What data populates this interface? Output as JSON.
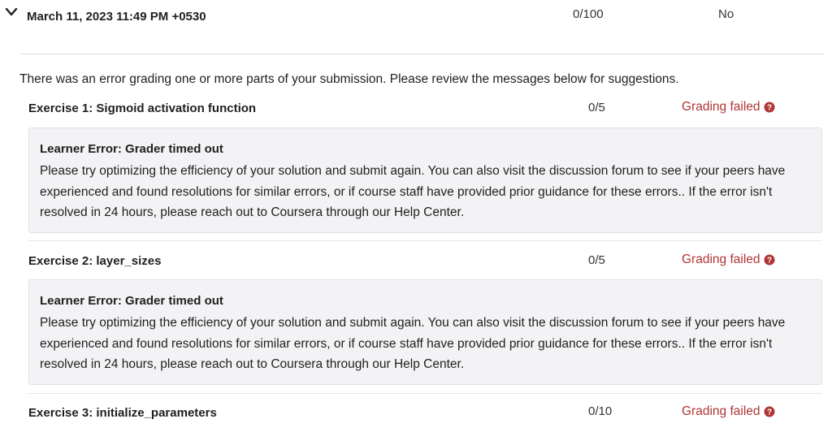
{
  "submission": {
    "date": "March 11, 2023 11:49 PM +0530",
    "score": "0/100",
    "passed": "No"
  },
  "error_message": "There was an error grading one or more parts of your submission. Please review the messages below for suggestions.",
  "exercises": [
    {
      "title": "Exercise 1: Sigmoid activation function",
      "score": "0/5",
      "status": "Grading failed",
      "error": {
        "title": "Learner Error: Grader timed out",
        "body": "Please try optimizing the efficiency of your solution and submit again. You can also visit the discussion forum to see if your peers have experienced and found resolutions for similar errors, or if course staff have provided prior guidance for these errors.. If the error isn't resolved in 24 hours, please reach out to Coursera through our Help Center."
      }
    },
    {
      "title": "Exercise 2: layer_sizes",
      "score": "0/5",
      "status": "Grading failed",
      "error": {
        "title": "Learner Error: Grader timed out",
        "body": "Please try optimizing the efficiency of your solution and submit again. You can also visit the discussion forum to see if your peers have experienced and found resolutions for similar errors, or if course staff have provided prior guidance for these errors.. If the error isn't resolved in 24 hours, please reach out to Coursera through our Help Center."
      }
    },
    {
      "title": "Exercise 3: initialize_parameters",
      "score": "0/10",
      "status": "Grading failed"
    }
  ],
  "icons": {
    "expand": "chevron-down-icon",
    "help": "question-circle-icon"
  },
  "colors": {
    "status_failed": "#b03636",
    "error_box_bg": "#f3f3f5"
  }
}
